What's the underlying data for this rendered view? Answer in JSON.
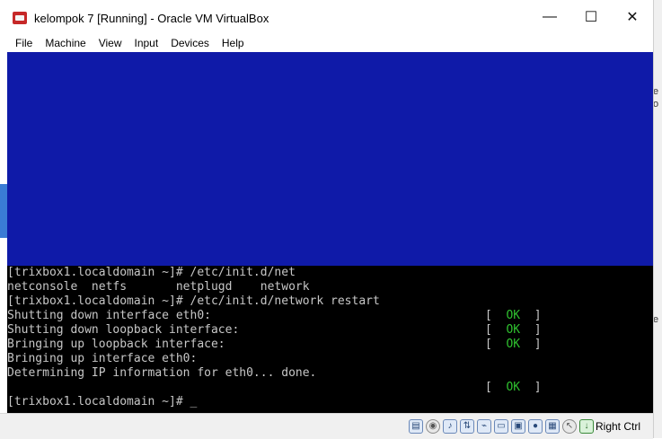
{
  "window": {
    "title": "kelompok 7 [Running] - Oracle VM VirtualBox",
    "minimize_glyph": "—",
    "maximize_glyph": "☐",
    "close_glyph": "✕"
  },
  "menu": [
    {
      "label": "File"
    },
    {
      "label": "Machine"
    },
    {
      "label": "View"
    },
    {
      "label": "Input"
    },
    {
      "label": "Devices"
    },
    {
      "label": "Help"
    }
  ],
  "terminal": {
    "lines": [
      "[trixbox1.localdomain ~]# /etc/init.d/net",
      "netconsole  netfs       netplugd    network",
      "[trixbox1.localdomain ~]# /etc/init.d/network restart",
      "Shutting down interface eth0:",
      "Shutting down loopback interface:",
      "Bringing up loopback interface:",
      "Bringing up interface eth0:",
      "Determining IP information for eth0... done.",
      "",
      "[trixbox1.localdomain ~]# _"
    ],
    "ok_rows": [
      {
        "open": "[  ",
        "text": "OK",
        "close": "  ]"
      },
      {
        "open": "[  ",
        "text": "OK",
        "close": "  ]"
      },
      {
        "open": "[  ",
        "text": "OK",
        "close": "  ]"
      },
      {
        "open": "[  ",
        "text": "OK",
        "close": "  ]"
      }
    ],
    "ok_color": "#2fc12f",
    "text_color": "#c7c7c7",
    "upper_screen_color": "#0f1aa8"
  },
  "statusbar": {
    "icons": [
      "hard-disk-icon",
      "optical-drive-icon",
      "audio-icon",
      "network-icon",
      "usb-icon",
      "shared-folders-icon",
      "display-icon",
      "video-capture-icon",
      "virtualization-icon",
      "mouse-integration-icon",
      "host-key-icon"
    ],
    "host_key_label": "Right Ctrl"
  },
  "desktop": {
    "fragment_1": "e",
    "fragment_2": "o",
    "fragment_3": "e"
  }
}
